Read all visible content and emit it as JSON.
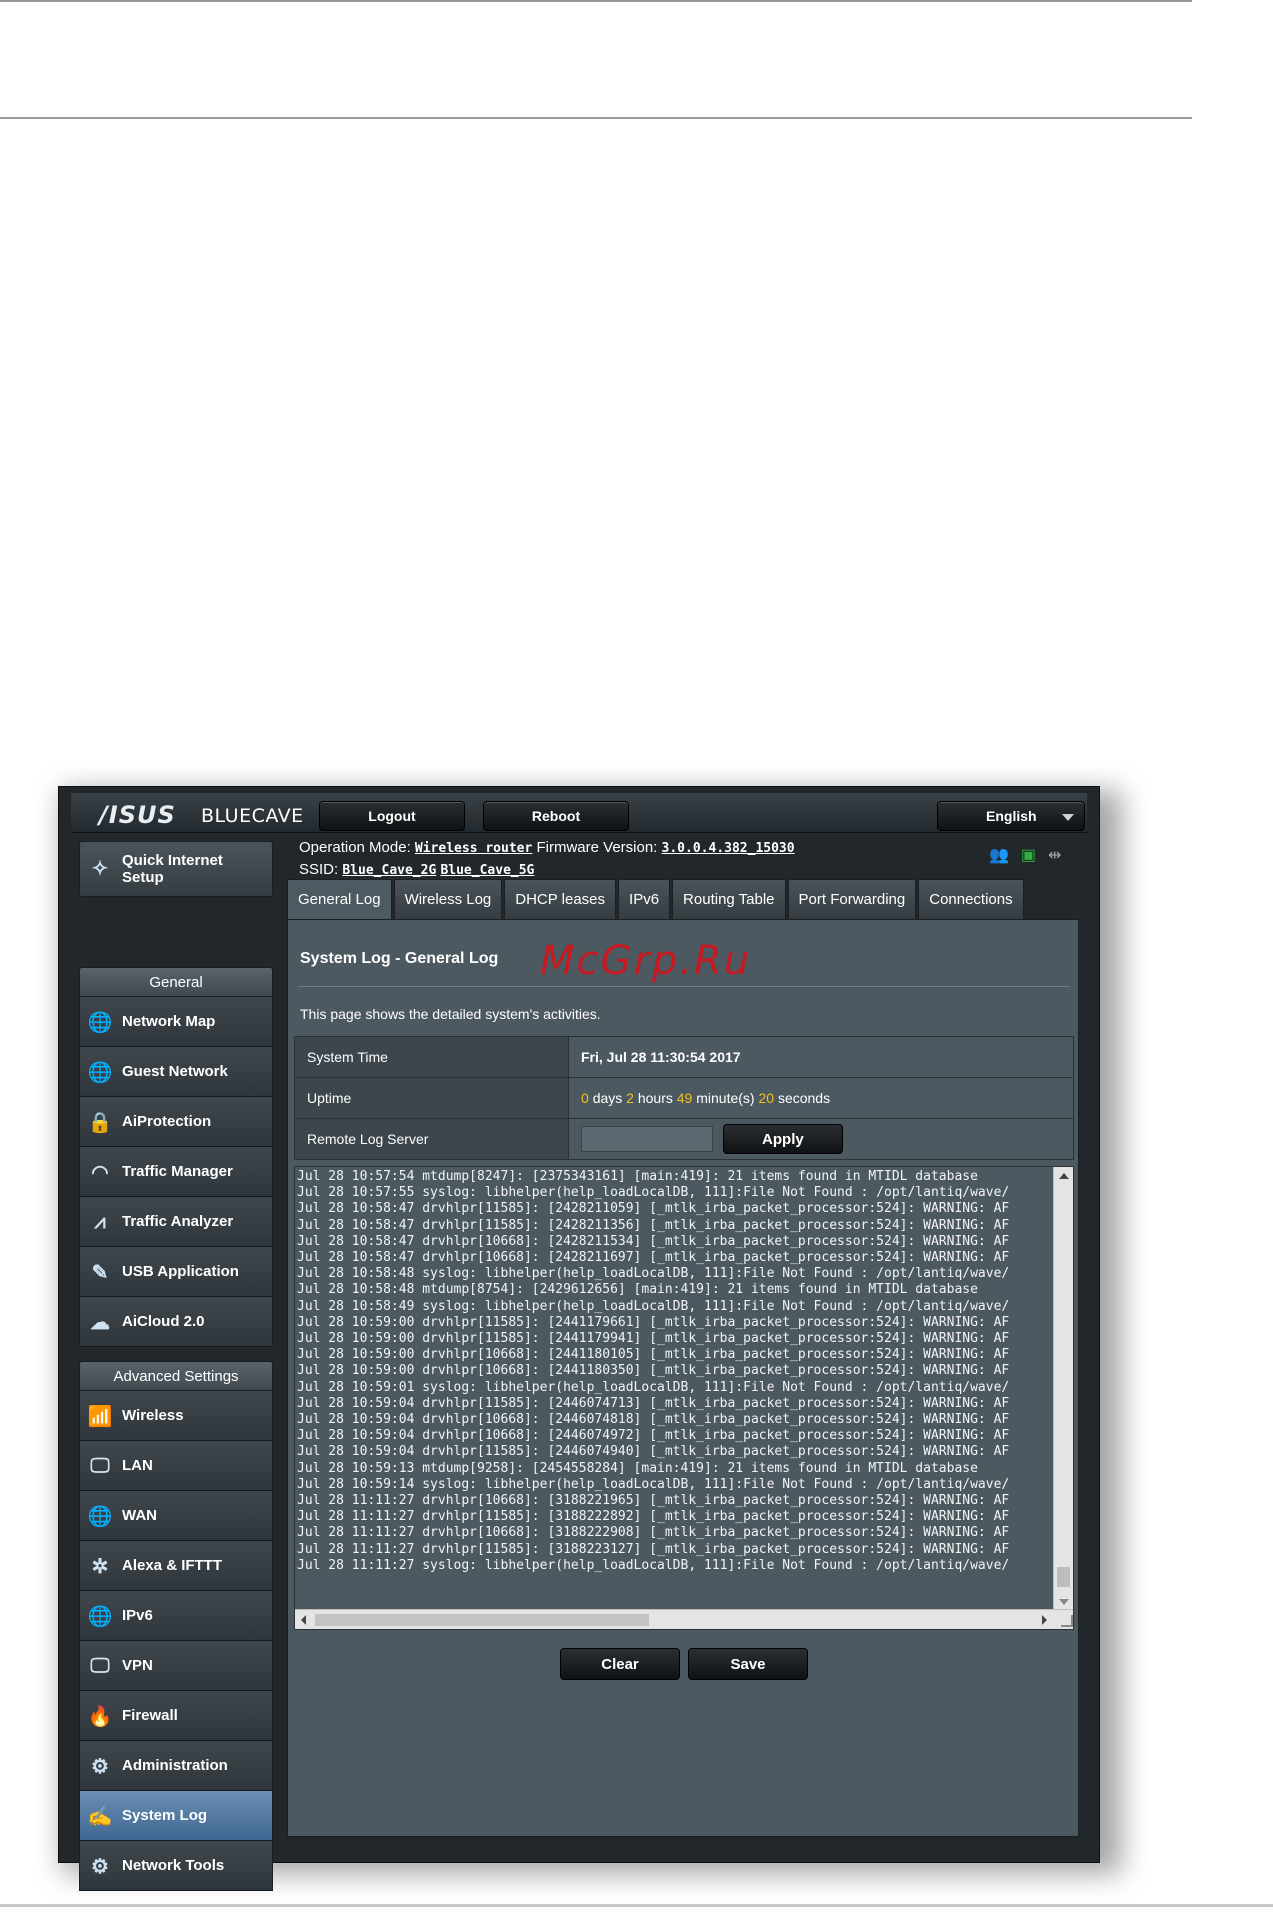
{
  "header": {
    "brand": "/ISUS",
    "model": "BLUECAVE",
    "logout_label": "Logout",
    "reboot_label": "Reboot",
    "language": "English"
  },
  "info": {
    "operation_mode_label": "Operation Mode:",
    "operation_mode_value": "Wireless router",
    "firmware_label": "Firmware Version:",
    "firmware_value": "3.0.0.4.382_15030",
    "ssid_label": "SSID:",
    "ssid_2g": "Blue_Cave_2G",
    "ssid_5g": "Blue_Cave_5G"
  },
  "sidebar": {
    "quick_setup": "Quick Internet Setup",
    "general_header": "General",
    "general_items": [
      "Network Map",
      "Guest Network",
      "AiProtection",
      "Traffic Manager",
      "Traffic Analyzer",
      "USB Application",
      "AiCloud 2.0"
    ],
    "advanced_header": "Advanced Settings",
    "advanced_items": [
      "Wireless",
      "LAN",
      "WAN",
      "Alexa & IFTTT",
      "IPv6",
      "VPN",
      "Firewall",
      "Administration",
      "System Log",
      "Network Tools"
    ],
    "active_item": "System Log"
  },
  "tabs": [
    "General Log",
    "Wireless Log",
    "DHCP leases",
    "IPv6",
    "Routing Table",
    "Port Forwarding",
    "Connections"
  ],
  "main": {
    "title": "System Log - General Log",
    "watermark": "McGrp.Ru",
    "description": "This page shows the detailed system's activities.",
    "system_time_label": "System Time",
    "system_time_value": "Fri, Jul 28 11:30:54 2017",
    "uptime_label": "Uptime",
    "uptime_days": "0",
    "uptime_days_unit": "days",
    "uptime_hours": "2",
    "uptime_hours_unit": "hours",
    "uptime_minutes": "49",
    "uptime_minutes_unit": "minute(s)",
    "uptime_seconds": "20",
    "uptime_seconds_unit": "seconds",
    "remote_log_label": "Remote Log Server",
    "apply_label": "Apply",
    "clear_label": "Clear",
    "save_label": "Save"
  },
  "log_lines": [
    "Jul 28 10:57:54 mtdump[8247]: [2375343161] [main:419]: 21 items found in MTIDL database",
    "Jul 28 10:57:55 syslog: libhelper(help_loadLocalDB, 111]:File Not Found : /opt/lantiq/wave/",
    "Jul 28 10:58:47 drvhlpr[11585]: [2428211059] [_mtlk_irba_packet_processor:524]: WARNING: AF",
    "Jul 28 10:58:47 drvhlpr[11585]: [2428211356] [_mtlk_irba_packet_processor:524]: WARNING: AF",
    "Jul 28 10:58:47 drvhlpr[10668]: [2428211534] [_mtlk_irba_packet_processor:524]: WARNING: AF",
    "Jul 28 10:58:47 drvhlpr[10668]: [2428211697] [_mtlk_irba_packet_processor:524]: WARNING: AF",
    "Jul 28 10:58:48 syslog: libhelper(help_loadLocalDB, 111]:File Not Found : /opt/lantiq/wave/",
    "Jul 28 10:58:48 mtdump[8754]: [2429612656] [main:419]: 21 items found in MTIDL database",
    "Jul 28 10:58:49 syslog: libhelper(help_loadLocalDB, 111]:File Not Found : /opt/lantiq/wave/",
    "Jul 28 10:59:00 drvhlpr[11585]: [2441179661] [_mtlk_irba_packet_processor:524]: WARNING: AF",
    "Jul 28 10:59:00 drvhlpr[11585]: [2441179941] [_mtlk_irba_packet_processor:524]: WARNING: AF",
    "Jul 28 10:59:00 drvhlpr[10668]: [2441180105] [_mtlk_irba_packet_processor:524]: WARNING: AF",
    "Jul 28 10:59:00 drvhlpr[10668]: [2441180350] [_mtlk_irba_packet_processor:524]: WARNING: AF",
    "Jul 28 10:59:01 syslog: libhelper(help_loadLocalDB, 111]:File Not Found : /opt/lantiq/wave/",
    "Jul 28 10:59:04 drvhlpr[11585]: [2446074713] [_mtlk_irba_packet_processor:524]: WARNING: AF",
    "Jul 28 10:59:04 drvhlpr[10668]: [2446074818] [_mtlk_irba_packet_processor:524]: WARNING: AF",
    "Jul 28 10:59:04 drvhlpr[10668]: [2446074972] [_mtlk_irba_packet_processor:524]: WARNING: AF",
    "Jul 28 10:59:04 drvhlpr[11585]: [2446074940] [_mtlk_irba_packet_processor:524]: WARNING: AF",
    "Jul 28 10:59:13 mtdump[9258]: [2454558284] [main:419]: 21 items found in MTIDL database",
    "Jul 28 10:59:14 syslog: libhelper(help_loadLocalDB, 111]:File Not Found : /opt/lantiq/wave/",
    "Jul 28 11:11:27 drvhlpr[10668]: [3188221965] [_mtlk_irba_packet_processor:524]: WARNING: AF",
    "Jul 28 11:11:27 drvhlpr[11585]: [3188222892] [_mtlk_irba_packet_processor:524]: WARNING: AF",
    "Jul 28 11:11:27 drvhlpr[10668]: [3188222908] [_mtlk_irba_packet_processor:524]: WARNING: AF",
    "Jul 28 11:11:27 drvhlpr[11585]: [3188223127] [_mtlk_irba_packet_processor:524]: WARNING: AF",
    "Jul 28 11:11:27 syslog: libhelper(help_loadLocalDB, 111]:File Not Found : /opt/lantiq/wave/"
  ],
  "icons": {
    "quick_setup": "wand-icon",
    "status": [
      "users-icon",
      "network-icon",
      "usb-icon"
    ]
  },
  "colors": {
    "accent_active": "#4f77a1",
    "highlight_number": "#f2c021",
    "panel_bg": "#4d5960",
    "watermark": "#d2141b"
  }
}
